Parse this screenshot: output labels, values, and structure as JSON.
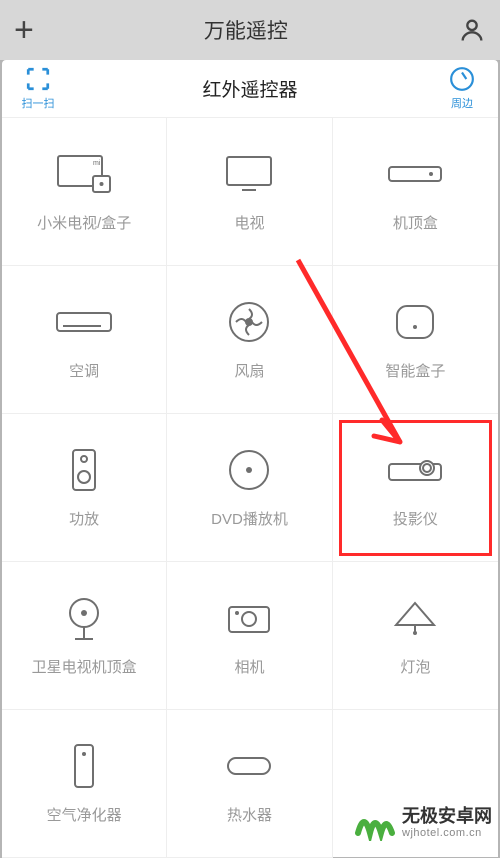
{
  "topbar": {
    "title": "万能遥控"
  },
  "modal": {
    "scan_label": "扫一扫",
    "title": "红外遥控器",
    "nearby_label": "周边"
  },
  "items": [
    {
      "label": "小米电视/盒子",
      "icon": "mi-tv"
    },
    {
      "label": "电视",
      "icon": "tv"
    },
    {
      "label": "机顶盒",
      "icon": "stb"
    },
    {
      "label": "空调",
      "icon": "ac"
    },
    {
      "label": "风扇",
      "icon": "fan"
    },
    {
      "label": "智能盒子",
      "icon": "smartbox"
    },
    {
      "label": "功放",
      "icon": "amp"
    },
    {
      "label": "DVD播放机",
      "icon": "dvd"
    },
    {
      "label": "投影仪",
      "icon": "projector"
    },
    {
      "label": "卫星电视机顶盒",
      "icon": "sat"
    },
    {
      "label": "相机",
      "icon": "camera"
    },
    {
      "label": "灯泡",
      "icon": "lamp"
    },
    {
      "label": "空气净化器",
      "icon": "purifier"
    },
    {
      "label": "热水器",
      "icon": "heater"
    }
  ],
  "watermark": {
    "cn": "无极安卓网",
    "en": "wjhotel.com.cn"
  },
  "highlight_index": 8,
  "colors": {
    "accent": "#2a8fd8",
    "highlight": "#ff2a2a",
    "icon": "#6f6f6f"
  }
}
